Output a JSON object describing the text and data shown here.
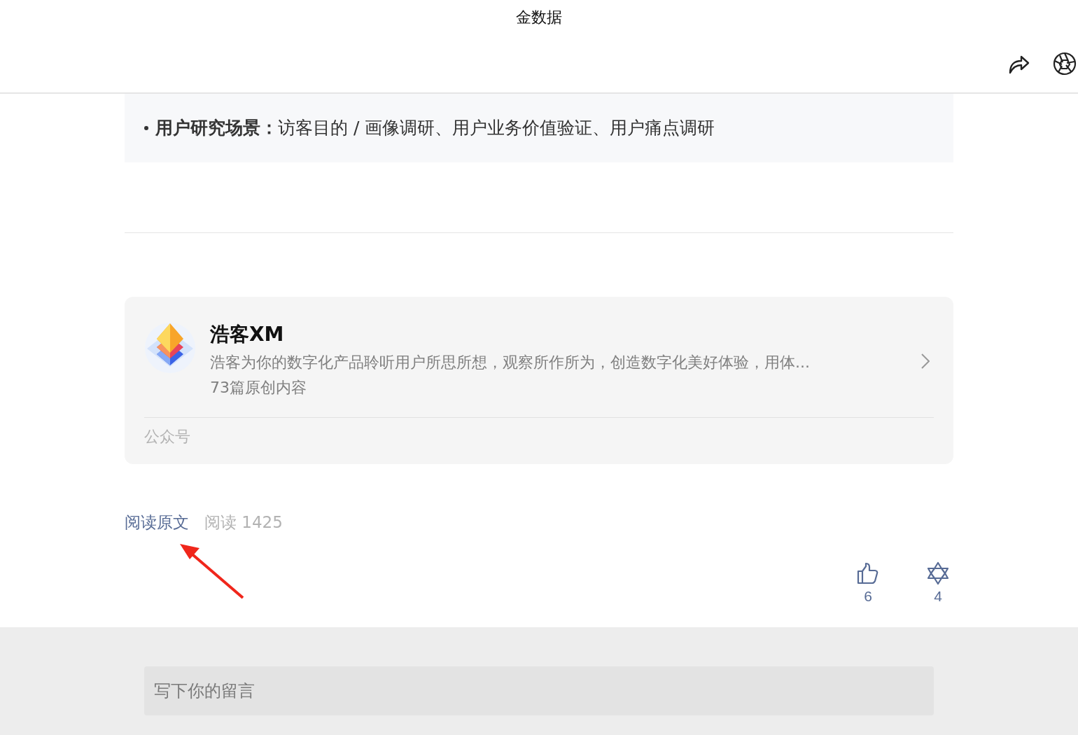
{
  "header": {
    "title": "金数据"
  },
  "article": {
    "bullet": "**用户研究场景：**访客目的 / 画像调研、用户业务价值验证、用户痛点调研"
  },
  "account_card": {
    "name": "浩客XM",
    "description": "浩客为你的数字化产品聆听用户所思所想，观察所作所为，创造数字化美好体验，用体...",
    "stats": "73篇原创内容",
    "footer": "公众号"
  },
  "read_row": {
    "link": "阅读原文",
    "reads": "阅读 1425"
  },
  "reactions": [
    {
      "kind": "like",
      "count": "6"
    },
    {
      "kind": "wow",
      "count": "4"
    }
  ],
  "comment": {
    "placeholder": "写下你的留言"
  }
}
